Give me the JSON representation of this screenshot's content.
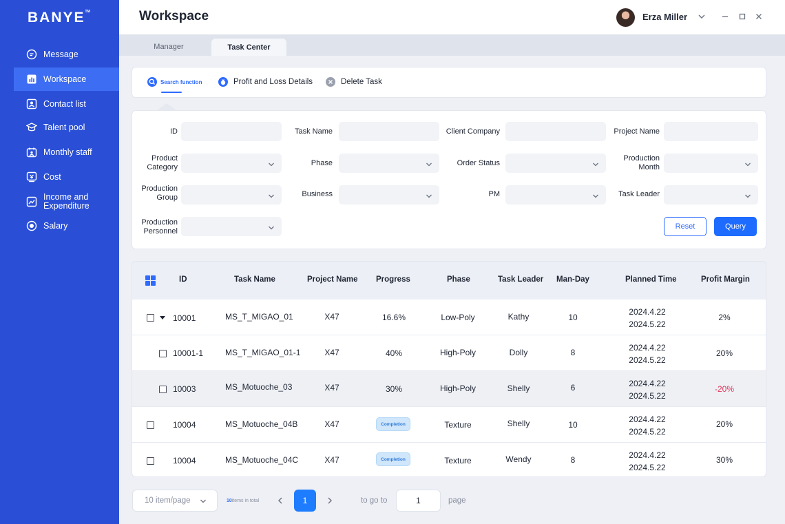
{
  "brand": {
    "logo": "BANYE",
    "tm": "TM"
  },
  "sidebar": {
    "items": [
      {
        "label": "Message",
        "icon": "message-icon",
        "active": false
      },
      {
        "label": "Workspace",
        "icon": "workspace-chart-icon",
        "active": true
      },
      {
        "label": "Contact list",
        "icon": "contact-card-icon",
        "active": false
      },
      {
        "label": "Talent pool",
        "icon": "graduation-cap-icon",
        "active": false
      },
      {
        "label": "Monthly staff",
        "icon": "calendar-user-icon",
        "active": false
      },
      {
        "label": "Cost",
        "icon": "cost-icon",
        "active": false
      },
      {
        "label": "Income and Expenditure",
        "icon": "trend-chart-icon",
        "active": false
      },
      {
        "label": "Salary",
        "icon": "salary-coin-icon",
        "active": false
      }
    ]
  },
  "header": {
    "title": "Workspace",
    "user_name": "Erza Miller"
  },
  "tabs": [
    {
      "label": "Manager",
      "active": false
    },
    {
      "label": "Task Center",
      "active": true
    }
  ],
  "functions": {
    "search": "Search function",
    "profit_loss": "Profit and Loss Details",
    "delete_task": "Delete Task"
  },
  "filters": {
    "id": "ID",
    "task_name": "Task Name",
    "client_company": "Client Company",
    "project_name": "Project Name",
    "product_category": "Product Category",
    "phase": "Phase",
    "order_status": "Order Status",
    "production_month": "Production Month",
    "production_group": "Production Group",
    "business": "Business",
    "pm": "PM",
    "task_leader": "Task Leader",
    "production_personnel": "Production Personnel",
    "reset": "Reset",
    "query": "Query"
  },
  "table": {
    "columns": [
      "ID",
      "Task Name",
      "Project Name",
      "Progress",
      "Phase",
      "Task Leader",
      "Man-Day",
      "Planned Time",
      "Profit Margin"
    ],
    "rows": [
      {
        "id": "10001",
        "task": "MS_T_MIGAO_01",
        "project": "X47",
        "progress": "16.6%",
        "phase": "Low-Poly",
        "leader": "Kathy",
        "manday": "10",
        "start": "2024.4.22",
        "end": "2024.5.22",
        "margin": "2%"
      },
      {
        "id": "10001-1",
        "task": "MS_T_MIGAO_01-1",
        "project": "X47",
        "progress": "40%",
        "phase": "High-Poly",
        "leader": "Dolly",
        "manday": "8",
        "start": "2024.4.22",
        "end": "2024.5.22",
        "margin": "20%"
      },
      {
        "id": "10003",
        "task": "MS_Motuoche_03",
        "project": "X47",
        "progress": "30%",
        "phase": "High-Poly",
        "leader": "Shelly",
        "manday": "6",
        "start": "2024.4.22",
        "end": "2024.5.22",
        "margin": "-20%"
      },
      {
        "id": "10004",
        "task": "MS_Motuoche_04B",
        "project": "X47",
        "progress": "Completion",
        "phase": "Texture",
        "leader": "Shelly",
        "manday": "10",
        "start": "2024.4.22",
        "end": "2024.5.22",
        "margin": "20%"
      },
      {
        "id": "10004",
        "task": "MS_Motuoche_04C",
        "project": "X47",
        "progress": "Completion",
        "phase": "Texture",
        "leader": "Wendy",
        "manday": "8",
        "start": "2024.4.22",
        "end": "2024.5.22",
        "margin": "30%"
      }
    ]
  },
  "pagination": {
    "page_size": "10 item/page",
    "total_count": "10",
    "total_suffix": "items in total",
    "current_page": "1",
    "goto_label": "to go to",
    "goto_value": "1",
    "page_label": "page"
  },
  "colors": {
    "sidebar": "#2a4fd6",
    "sidebar_active": "#3d6df2",
    "accent": "#1e6bff",
    "negative": "#e0355a",
    "badge_bg": "#cfe6fb"
  }
}
